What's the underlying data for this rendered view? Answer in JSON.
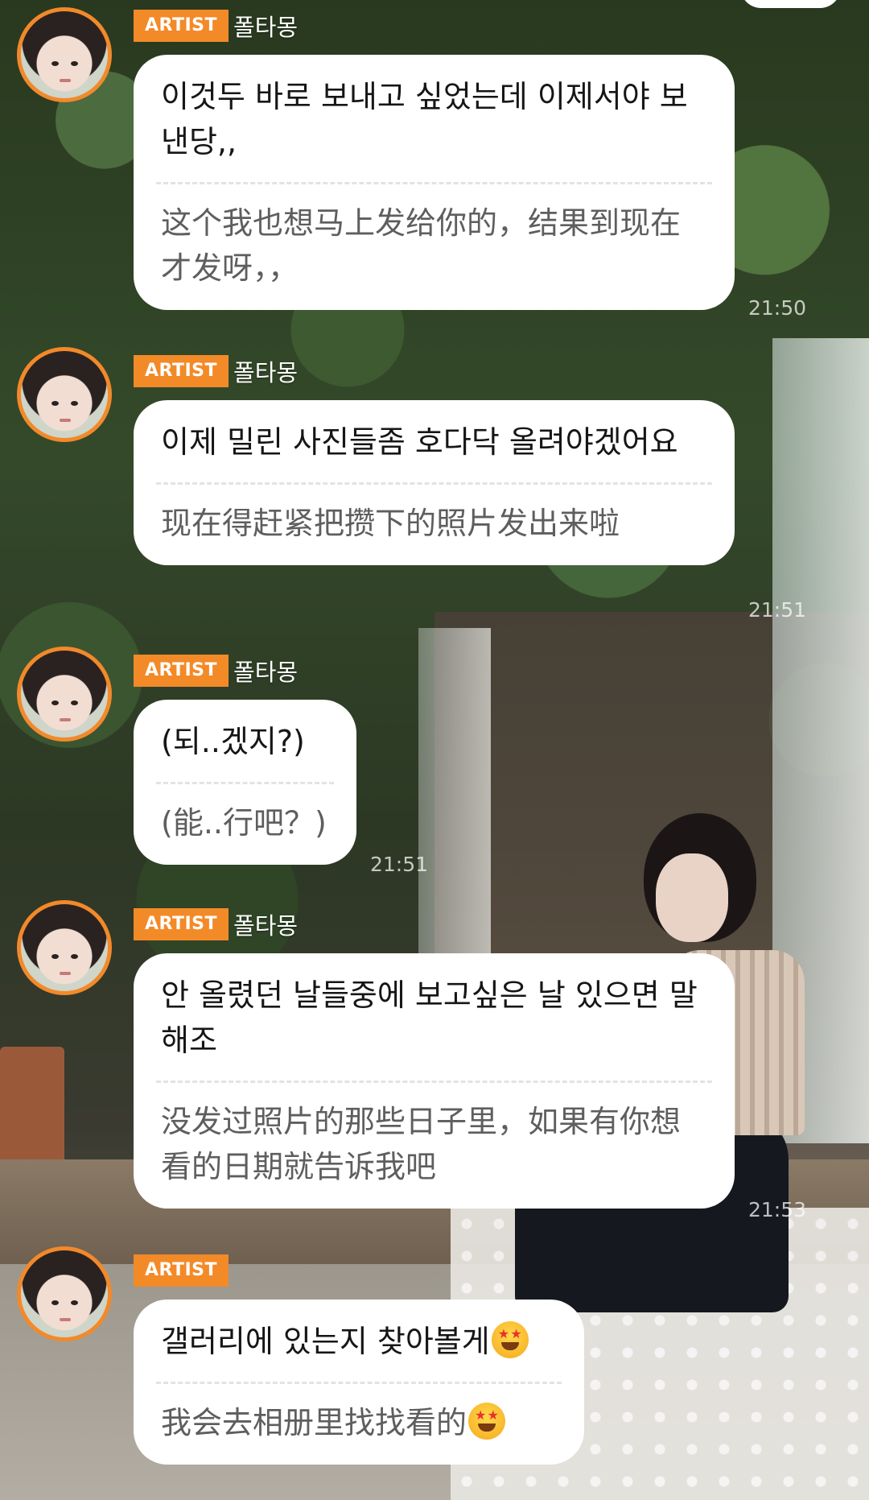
{
  "messages": [
    {
      "badge": "ARTIST",
      "name": "폴타몽",
      "original": "이것두 바로 보내고 싶었는데 이제서야 보낸당,,",
      "translation": "这个我也想马上发给你的，结果到现在才发呀，，",
      "time": "21:50"
    },
    {
      "badge": "ARTIST",
      "name": "폴타몽",
      "original": "이제 밀린 사진들좀 호다닥 올려야겠어요",
      "translation": "现在得赶紧把攒下的照片发出来啦",
      "time": "21:51"
    },
    {
      "badge": "ARTIST",
      "name": "폴타몽",
      "original": "(되..겠지?)",
      "translation": "(能..行吧？)",
      "time": "21:51"
    },
    {
      "badge": "ARTIST",
      "name": "폴타몽",
      "original": "안 올렸던 날들중에 보고싶은 날 있으면 말해조",
      "translation": "没发过照片的那些日子里，如果有你想看的日期就告诉我吧",
      "time": "21:53"
    },
    {
      "badge": "ARTIST",
      "name": "",
      "original": "갤러리에 있는지 찾아볼게",
      "translation": "我会去相册里找找看的",
      "emoji": "star-struck-emoji"
    }
  ]
}
